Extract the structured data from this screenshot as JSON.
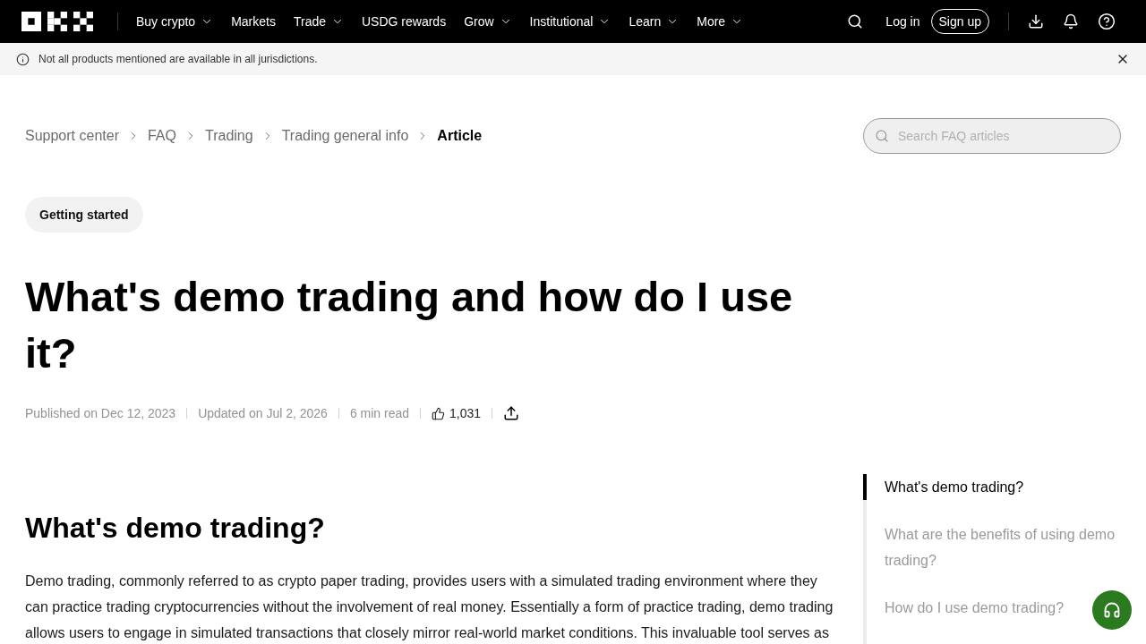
{
  "nav": {
    "items": [
      {
        "label": "Buy crypto",
        "has_menu": true
      },
      {
        "label": "Markets",
        "has_menu": false
      },
      {
        "label": "Trade",
        "has_menu": true
      },
      {
        "label": "USDG rewards",
        "has_menu": false
      },
      {
        "label": "Grow",
        "has_menu": true
      },
      {
        "label": "Institutional",
        "has_menu": true
      },
      {
        "label": "Learn",
        "has_menu": true
      },
      {
        "label": "More",
        "has_menu": true
      }
    ],
    "login": "Log in",
    "signup": "Sign up"
  },
  "notice": {
    "text": "Not all products mentioned are available in all jurisdictions."
  },
  "breadcrumb": [
    {
      "label": "Support center",
      "current": false
    },
    {
      "label": "FAQ",
      "current": false
    },
    {
      "label": "Trading",
      "current": false
    },
    {
      "label": "Trading general info",
      "current": false
    },
    {
      "label": "Article",
      "current": true
    }
  ],
  "search": {
    "placeholder": "Search FAQ articles"
  },
  "article": {
    "tag": "Getting started",
    "title": "What's demo trading and how do I use it?",
    "meta": {
      "published": "Published on Dec 12, 2023",
      "updated": "Updated on Jul 2, 2026",
      "read_time": "6 min read",
      "likes": "1,031"
    },
    "sections": [
      {
        "heading": "What's demo trading?",
        "paragraphs": [
          "Demo trading, commonly referred to as crypto paper trading, provides users with a simulated trading environment where they can practice trading cryptocurrencies without the involvement of real money. Essentially a form of practice trading, demo trading allows users to engage in simulated transactions that closely mirror real-world market conditions. This invaluable tool serves as"
        ]
      }
    ]
  },
  "toc": [
    {
      "label": "What's demo trading?",
      "selected": true
    },
    {
      "label": "What are the benefits of using demo trading?",
      "selected": false
    },
    {
      "label": "How do I use demo trading?",
      "selected": false
    }
  ]
}
